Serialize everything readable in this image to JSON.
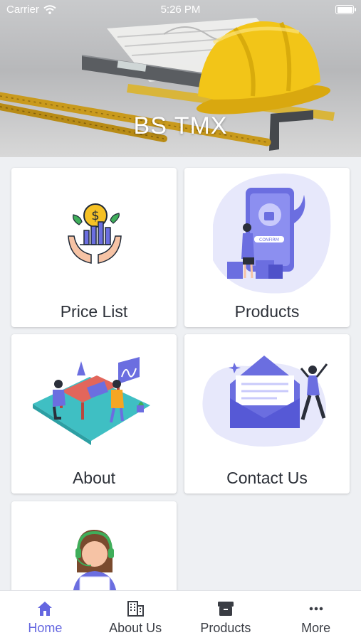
{
  "status_bar": {
    "carrier": "Carrier",
    "time": "5:26 PM"
  },
  "hero": {
    "title": "BS TMX"
  },
  "cards": [
    {
      "label": "Price List"
    },
    {
      "label": "Products"
    },
    {
      "label": "About"
    },
    {
      "label": "Contact Us"
    },
    {
      "label": ""
    }
  ],
  "illustration_text": {
    "confirm": "CONFIRM"
  },
  "tabs": [
    {
      "label": "Home",
      "icon": "home-icon",
      "active": true
    },
    {
      "label": "About Us",
      "icon": "building-icon",
      "active": false
    },
    {
      "label": "Products",
      "icon": "archive-box-icon",
      "active": false
    },
    {
      "label": "More",
      "icon": "more-dots-icon",
      "active": false
    }
  ],
  "colors": {
    "accent": "#6466e0",
    "helmet": "#f2c518"
  }
}
